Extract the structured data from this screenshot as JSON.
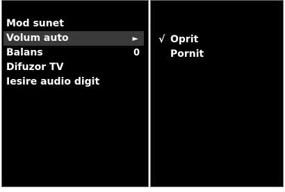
{
  "menu": {
    "items": [
      {
        "label": "Mod sunet",
        "value": "",
        "selected": false
      },
      {
        "label": "Volum auto",
        "value": "",
        "selected": true,
        "submenu_indicator": "►"
      },
      {
        "label": "Balans",
        "value": "0",
        "selected": false
      },
      {
        "label": "Difuzor TV",
        "value": "",
        "selected": false
      },
      {
        "label": "Iesire audio digit",
        "value": "",
        "selected": false
      }
    ]
  },
  "submenu": {
    "options": [
      {
        "check": "√",
        "label": "Oprit",
        "checked": true
      },
      {
        "check": "",
        "label": "Pornit",
        "checked": false
      }
    ]
  },
  "colors": {
    "background": "#000000",
    "text": "#ffffff",
    "highlight": "#3a3a3a",
    "border": "#6e6e6e",
    "page": "#ffffff"
  }
}
